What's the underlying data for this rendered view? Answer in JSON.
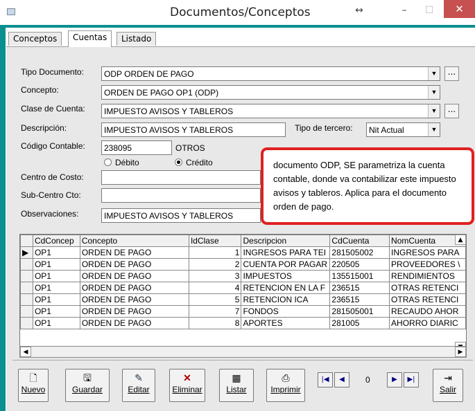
{
  "window": {
    "title": "Documentos/Conceptos",
    "resize_glyph": "↔",
    "minimize": "–",
    "maximize": "☐",
    "close": "✕"
  },
  "tabs": [
    {
      "label": "Conceptos"
    },
    {
      "label": "Cuentas"
    },
    {
      "label": "Listado"
    }
  ],
  "form": {
    "tipo_documento": {
      "label": "Tipo Documento:",
      "value": "ODP  ORDEN DE PAGO"
    },
    "concepto": {
      "label": "Concepto:",
      "value": "ORDEN DE PAGO OP1  (ODP)"
    },
    "clase_cuenta": {
      "label": "Clase de Cuenta:",
      "value": "IMPUESTO AVISOS Y TABLEROS"
    },
    "descripcion": {
      "label": "Descripción:",
      "value": "IMPUESTO AVISOS Y TABLEROS"
    },
    "tipo_tercero": {
      "label": "Tipo de tercero:",
      "value": "Nit Actual"
    },
    "codigo_contable": {
      "label": "Código Contable:",
      "value": "238095",
      "name": "OTROS"
    },
    "debito": "Débito",
    "credito": "Crédito",
    "centro_costo": {
      "label": "Centro de Costo:",
      "value": ""
    },
    "subcentro": {
      "label": "Sub-Centro Cto:",
      "value": ""
    },
    "observaciones": {
      "label": "Observaciones:",
      "value": "IMPUESTO AVISOS Y TABLEROS"
    },
    "ellipsis": "..."
  },
  "callout": "documento ODP, SE parametriza la cuenta contable, donde va contabilizar este impuesto avisos y tableros. Aplica para el documento orden de pago.",
  "grid": {
    "columns": [
      "CdConcep",
      "Concepto",
      "IdClase",
      "Descripcion",
      "CdCuenta",
      "NomCuenta"
    ],
    "rows": [
      [
        "OP1",
        "ORDEN DE PAGO",
        "1",
        "INGRESOS PARA TEI",
        "281505002",
        "INGRESOS PARA"
      ],
      [
        "OP1",
        "ORDEN DE PAGO",
        "2",
        "CUENTA POR PAGAR",
        "220505",
        "PROVEEDORES \\"
      ],
      [
        "OP1",
        "ORDEN DE PAGO",
        "3",
        "IMPUESTOS",
        "135515001",
        "RENDIMIENTOS"
      ],
      [
        "OP1",
        "ORDEN DE PAGO",
        "4",
        "RETENCION EN LA F",
        "236515",
        "OTRAS RETENCI"
      ],
      [
        "OP1",
        "ORDEN DE PAGO",
        "5",
        "RETENCION ICA",
        "236515",
        "OTRAS RETENCI"
      ],
      [
        "OP1",
        "ORDEN DE PAGO",
        "7",
        "FONDOS",
        "281505001",
        "RECAUDO AHOR"
      ],
      [
        "OP1",
        "ORDEN DE PAGO",
        "8",
        "APORTES",
        "281005",
        "AHORRO DIARIC"
      ]
    ]
  },
  "toolbar": {
    "nuevo": "Nuevo",
    "guardar": "Guardar",
    "editar": "Editar",
    "eliminar": "Eliminar",
    "listar": "Listar",
    "imprimir": "Imprimir",
    "salir": "Salir",
    "record": "0"
  }
}
